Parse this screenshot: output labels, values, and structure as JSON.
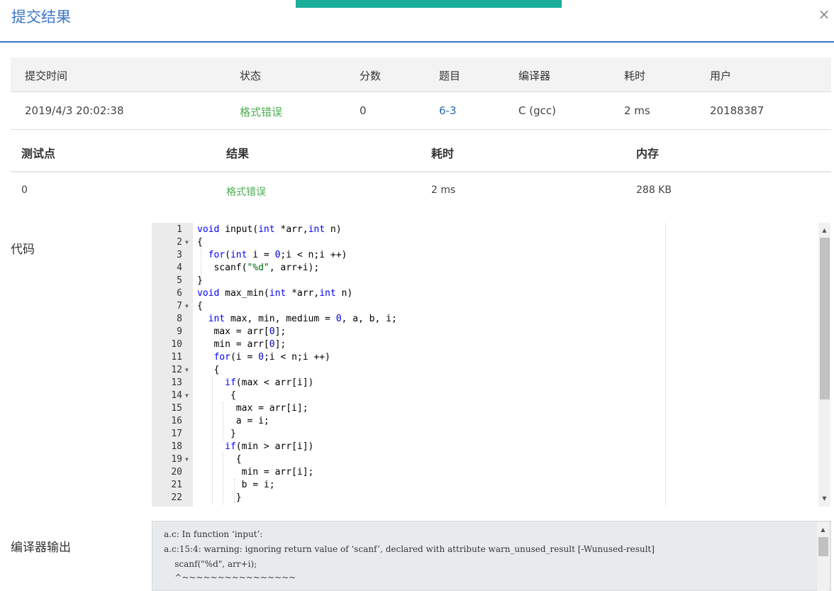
{
  "dialog": {
    "title": "提交结果",
    "close_symbol": "×",
    "accent_color": "#1aad9a",
    "title_color": "#3c76c7"
  },
  "submission": {
    "headers": [
      "提交时间",
      "状态",
      "分数",
      "题目",
      "编译器",
      "耗时",
      "用户"
    ],
    "row": {
      "time": "2019/4/3 20:02:38",
      "status": "格式错误",
      "score": "0",
      "problem": "6-3",
      "compiler": "C (gcc)",
      "duration": "2 ms",
      "user": "20188387"
    }
  },
  "testpoints": {
    "headers": [
      "测试点",
      "结果",
      "耗时",
      "内存"
    ],
    "rows": [
      {
        "id": "0",
        "result": "格式错误",
        "duration": "2 ms",
        "memory": "288 KB"
      }
    ]
  },
  "code_section": {
    "label": "代码",
    "lines": [
      "void input(int *arr,int n)",
      "{",
      "  for(int i = 0;i < n;i ++)",
      "   scanf(\"%d\", arr+i);",
      "}",
      "void max_min(int *arr,int n)",
      "{",
      "  int max, min, medium = 0, a, b, i;",
      "   max = arr[0];",
      "   min = arr[0];",
      "   for(i = 0;i < n;i ++)",
      "   {",
      "     if(max < arr[i])",
      "      {",
      "       max = arr[i];",
      "       a = i;",
      "      }",
      "     if(min > arr[i])",
      "       {",
      "        min = arr[i];",
      "        b = i;",
      "       }"
    ]
  },
  "compiler_section": {
    "label": "编译器输出",
    "output": [
      "a.c: In function ‘input’:",
      "a.c:15:4: warning: ignoring return value of ‘scanf’, declared with attribute warn_unused_result [-Wunused-result]",
      "    scanf(\"%d\", arr+i);",
      "    ^~~~~~~~~~~~~~~~~"
    ]
  }
}
